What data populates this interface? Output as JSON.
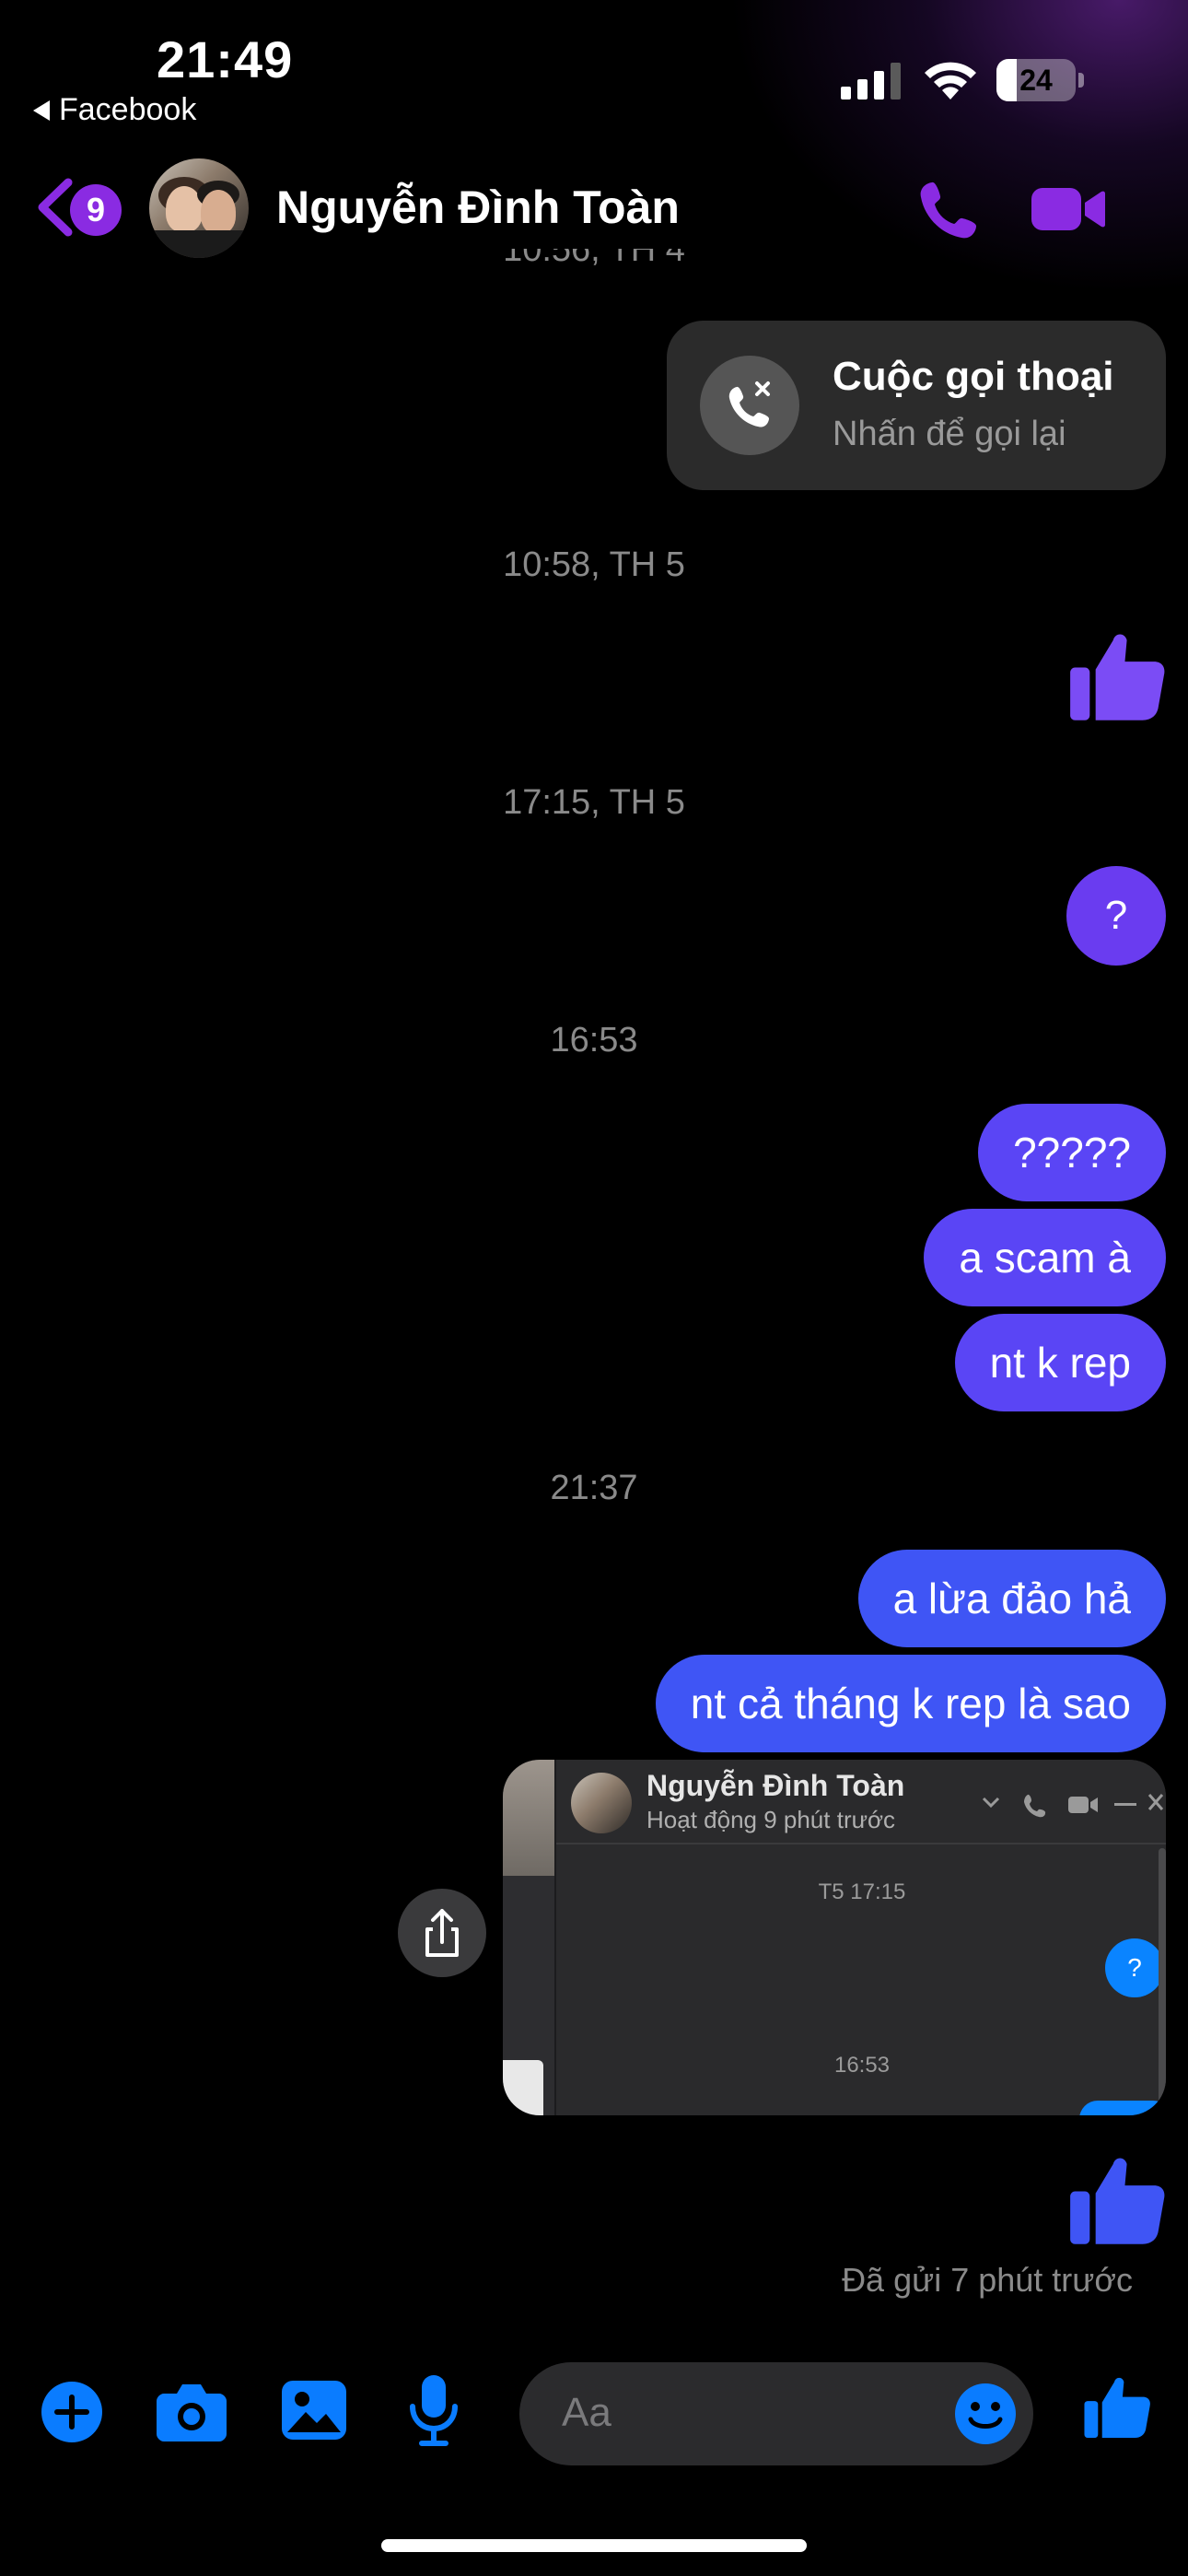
{
  "status_bar": {
    "time": "21:49",
    "back_app": "Facebook",
    "battery_level": "24"
  },
  "header": {
    "unread_count": "9",
    "contact_name": "Nguyễn Đình Toàn",
    "accent_color": "#8a2be2"
  },
  "chat": {
    "clipped_timestamp": "10:56, TH 4",
    "call_card": {
      "title": "Cuộc gọi thoại",
      "subtitle": "Nhấn để gọi lại"
    },
    "timestamps": [
      "10:58, TH 5",
      "17:15, TH 5",
      "16:53",
      "21:37"
    ],
    "question_mark": "?",
    "messages_group1": [
      "?????",
      "a scam à",
      "nt k rep"
    ],
    "messages_group2": [
      "a lừa đảo hả",
      "nt cả tháng k rep là sao"
    ],
    "screenshot": {
      "name": "Nguyễn Đình Toàn",
      "status": "Hoạt động 9 phút trước",
      "ts1": "T5 17:15",
      "q": "?",
      "ts2": "16:53"
    },
    "sent_status": "Đã gửi 7 phút trước"
  },
  "composer": {
    "placeholder": "Aa",
    "accent_color": "#0a7cff"
  }
}
